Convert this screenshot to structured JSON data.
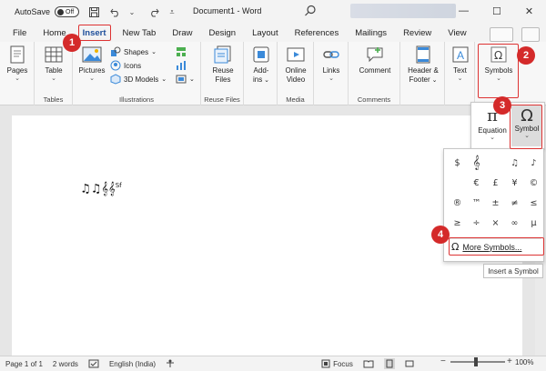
{
  "titlebar": {
    "autosave_label": "AutoSave",
    "toggle_state": "Off",
    "document_title": "Document1 - Word",
    "min_symbol": "—",
    "max_symbol": "☐",
    "close_symbol": "✕"
  },
  "tabs": [
    "File",
    "Home",
    "Insert",
    "New Tab",
    "Draw",
    "Design",
    "Layout",
    "References",
    "Mailings",
    "Review",
    "View"
  ],
  "ribbon": {
    "pages": {
      "label": "Pages"
    },
    "table": {
      "label": "Table",
      "group": "Tables"
    },
    "pictures": {
      "label": "Pictures"
    },
    "shapes": {
      "label": "Shapes"
    },
    "icons": {
      "label": "Icons"
    },
    "models": {
      "label": "3D Models"
    },
    "illustrations_group": "Illustrations",
    "reuse": {
      "label1": "Reuse",
      "label2": "Files",
      "group": "Reuse Files"
    },
    "addins": {
      "label1": "Add-",
      "label2": "ins"
    },
    "online_video": {
      "label1": "Online",
      "label2": "Video",
      "group": "Media"
    },
    "links": {
      "label": "Links"
    },
    "comment": {
      "label": "Comment",
      "group": "Comments"
    },
    "header_footer": {
      "label1": "Header &",
      "label2": "Footer"
    },
    "text": {
      "label": "Text"
    },
    "symbols": {
      "label": "Symbols"
    }
  },
  "symbols_dropdown": {
    "equation": {
      "icon_char": "π",
      "label": "Equation"
    },
    "symbol": {
      "icon_char": "Ω",
      "label": "Symbol"
    }
  },
  "symbol_gallery": {
    "symbols": [
      "$",
      "𝄞",
      "",
      "♫",
      "♪",
      "",
      "€",
      "£",
      "¥",
      "©",
      "®",
      "™",
      "±",
      "≠",
      "≤",
      "≥",
      "÷",
      "×",
      "∞",
      "µ"
    ],
    "more_icon": "Ω",
    "more_label": "More Symbols..."
  },
  "tooltip": "Insert a Symbol",
  "document": {
    "notes": "♫♫",
    "clef": "𝄞𝄞",
    "sf": "Sf"
  },
  "callouts": [
    "1",
    "2",
    "3",
    "4"
  ],
  "statusbar": {
    "page": "Page 1 of 1",
    "words": "2 words",
    "language": "English (India)",
    "focus": "Focus",
    "zoom": "100%",
    "zoom_level_percent": 100
  },
  "colors": {
    "callout": "#d42a2a",
    "active_tab_text": "#1e4f9b"
  }
}
